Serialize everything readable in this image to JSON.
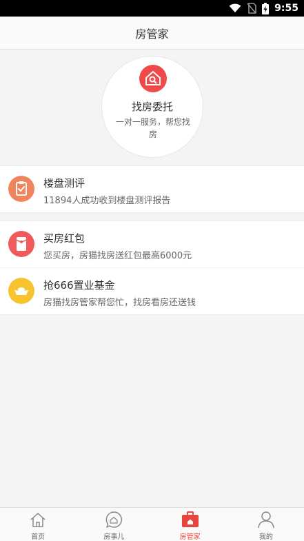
{
  "status_bar": {
    "time": "9:55",
    "icons": [
      "wifi-icon",
      "no-sim-icon",
      "battery-charging-icon"
    ]
  },
  "header": {
    "title": "房管家"
  },
  "hero": {
    "icon": "house-search-icon",
    "title": "找房委托",
    "description": "一对一服务，帮您找房"
  },
  "sections": [
    {
      "items": [
        {
          "icon": "clipboard-check-icon",
          "icon_color": "#f0855d",
          "title": "楼盘测评",
          "description": "11894人成功收到楼盘测评报告"
        }
      ]
    },
    {
      "items": [
        {
          "icon": "red-envelope-icon",
          "icon_color": "#ef5a5a",
          "title": "买房红包",
          "description": "您买房，房猫找房送红包最高6000元"
        },
        {
          "icon": "gold-ingot-icon",
          "icon_color": "#f7c42f",
          "title": "抢666置业基金",
          "description": "房猫找房管家帮您忙，找房看房还送钱"
        }
      ]
    }
  ],
  "tab_bar": {
    "active_index": 2,
    "active_color": "#e8453c",
    "tabs": [
      {
        "label": "首页",
        "icon": "home-icon"
      },
      {
        "label": "房事儿",
        "icon": "house-chat-icon"
      },
      {
        "label": "房管家",
        "icon": "briefcase-icon"
      },
      {
        "label": "我的",
        "icon": "person-icon"
      }
    ]
  }
}
